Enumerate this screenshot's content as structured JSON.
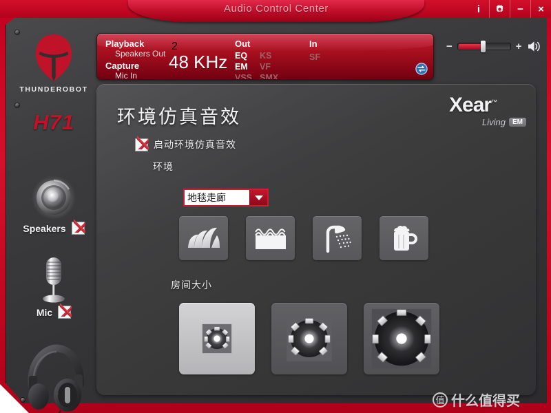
{
  "window": {
    "title": "Audio Control Center",
    "buttons": [
      {
        "name": "info",
        "glyph": "i"
      },
      {
        "name": "settings",
        "glyph": "gear"
      },
      {
        "name": "minimize",
        "glyph": "−"
      },
      {
        "name": "close",
        "glyph": "×"
      }
    ]
  },
  "sidebar": {
    "brand_name": "THUNDEROBOT",
    "model": "H71",
    "logo_icon": "thunderobot-helmet-icon",
    "devices": [
      {
        "label": "Speakers",
        "icon": "speaker-icon",
        "checked": true
      },
      {
        "label": "Mic",
        "icon": "microphone-icon",
        "checked": true
      }
    ],
    "product_image": "headphones-image"
  },
  "status": {
    "playback_label": "Playback",
    "playback_device": "Speakers Out",
    "capture_label": "Capture",
    "capture_device": "Mic In",
    "channels": "2",
    "sample_rate": "48  KHz",
    "out_label": "Out",
    "in_label": "In",
    "out_flags": [
      {
        "label": "EQ",
        "active": true
      },
      {
        "label": "KS",
        "active": false
      },
      {
        "label": "EM",
        "active": true
      },
      {
        "label": "VF",
        "active": false
      },
      {
        "label": "VSS",
        "active": false
      },
      {
        "label": "SMX",
        "active": false
      }
    ],
    "in_flags": [
      {
        "label": "SF",
        "active": false
      }
    ],
    "swap_icon": "swap-arrows-icon"
  },
  "volume": {
    "decrease_label": "−",
    "increase_label": "+",
    "level_percent": 46,
    "speaker_icon": "volume-speaker-icon"
  },
  "main": {
    "page_title": "环境仿真音效",
    "enable_checkbox_label": "启动环境仿真音效",
    "enable_checked": true,
    "environment_label": "环境",
    "environment_value": "地毯走廊",
    "presets": [
      {
        "name": "concert-hall-preset",
        "icon": "concert-hall-icon"
      },
      {
        "name": "underwater-preset",
        "icon": "water-waves-icon"
      },
      {
        "name": "bathroom-preset",
        "icon": "shower-icon"
      },
      {
        "name": "stone-room-preset",
        "icon": "beer-mug-icon"
      }
    ],
    "room_size_label": "房间大小",
    "room_sizes": [
      {
        "name": "room-size-small",
        "selected": true
      },
      {
        "name": "room-size-medium",
        "selected": false
      },
      {
        "name": "room-size-large",
        "selected": false
      }
    ]
  },
  "xear": {
    "brand": "Xear",
    "tm": "™",
    "tagline": "Living",
    "badge": "EM"
  },
  "watermark": {
    "badge": "值",
    "text": "什么值得买"
  },
  "colors": {
    "accent_red": "#c3001f",
    "panel_dark": "#3a3a3c",
    "status_red": "#a9101f"
  }
}
